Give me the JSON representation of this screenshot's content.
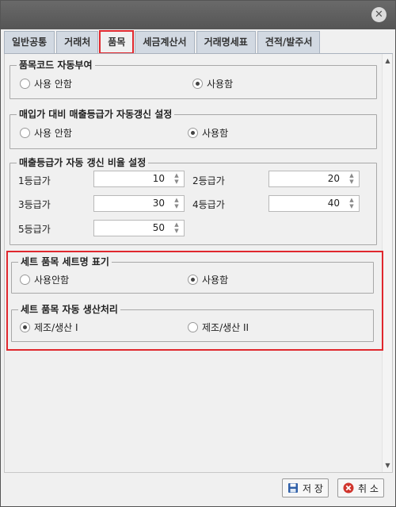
{
  "tabs": [
    "일반공통",
    "거래처",
    "품목",
    "세금계산서",
    "거래명세표",
    "견적/발주서"
  ],
  "group1": {
    "title": "품목코드 자동부여",
    "opt_off": "사용 안함",
    "opt_on": "사용함"
  },
  "group2": {
    "title": "매입가 대비 매출등급가 자동갱신 설정",
    "opt_off": "사용 안함",
    "opt_on": "사용함"
  },
  "group3": {
    "title": "매출등급가 자동 갱신 비율 설정",
    "grades": [
      {
        "label": "1등급가",
        "value": "10"
      },
      {
        "label": "2등급가",
        "value": "20"
      },
      {
        "label": "3등급가",
        "value": "30"
      },
      {
        "label": "4등급가",
        "value": "40"
      },
      {
        "label": "5등급가",
        "value": "50"
      }
    ]
  },
  "group4": {
    "title": "세트 품목 세트명 표기",
    "opt_off": "사용안함",
    "opt_on": "사용함"
  },
  "group5": {
    "title": "세트 품목 자동 생산처리",
    "opt_1": "제조/생산 I",
    "opt_2": "제조/생산 II"
  },
  "buttons": {
    "save": "저 장",
    "cancel": "취 소"
  },
  "colors": {
    "highlight": "#e0282e",
    "tab_bg": "#d2d9e2"
  }
}
